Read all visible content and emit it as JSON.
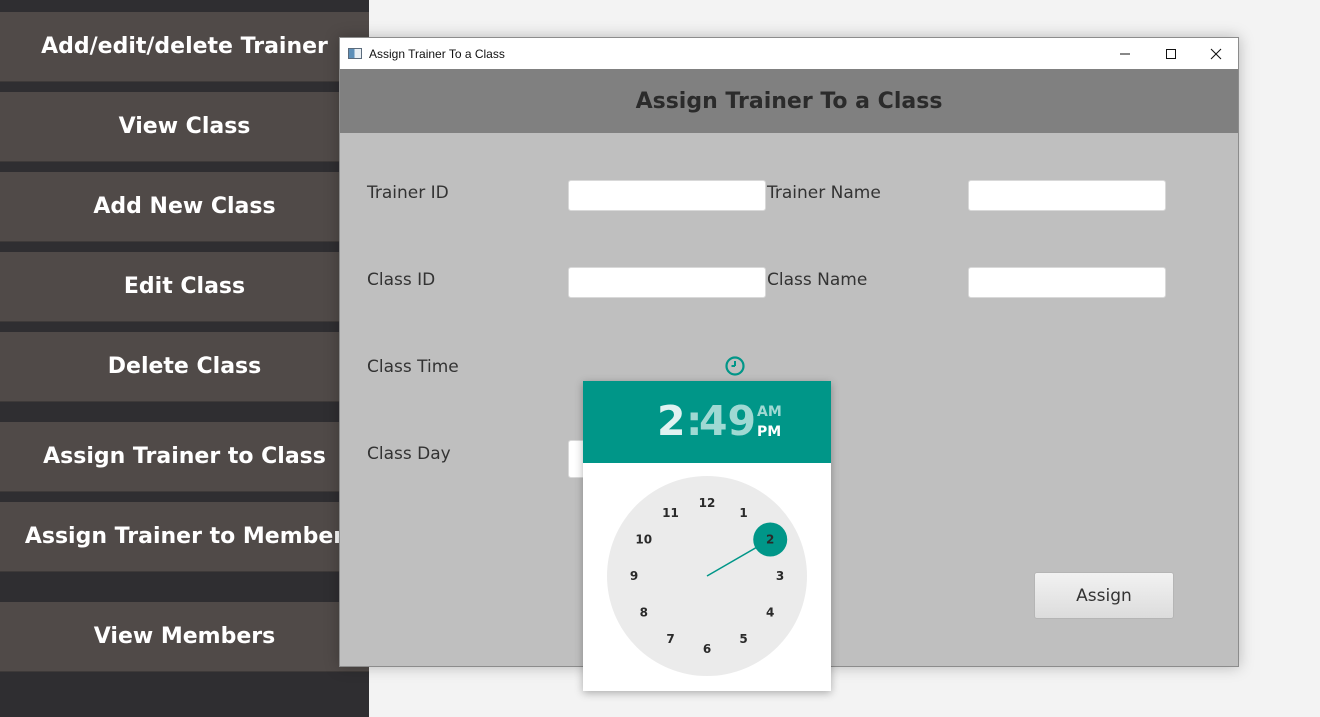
{
  "sidebar": {
    "items": [
      {
        "label": "Add/edit/delete Trainer"
      },
      {
        "label": "View Class"
      },
      {
        "label": "Add New Class"
      },
      {
        "label": "Edit Class"
      },
      {
        "label": "Delete Class"
      },
      {
        "label": "Assign Trainer to Class"
      },
      {
        "label": "Assign Trainer to Member"
      },
      {
        "label": "View Members"
      }
    ]
  },
  "window": {
    "title": "Assign Trainer To a Class",
    "header": "Assign Trainer To a Class",
    "controls": [
      "minimize-icon",
      "maximize-icon",
      "close-icon"
    ]
  },
  "form": {
    "trainer_id_label": "Trainer ID",
    "trainer_id_value": "",
    "trainer_name_label": "Trainer Name",
    "trainer_name_value": "",
    "class_id_label": "Class ID",
    "class_id_value": "",
    "class_name_label": "Class Name",
    "class_name_value": "",
    "class_time_label": "Class Time",
    "class_day_label": "Class Day",
    "assign_label": "Assign"
  },
  "time_picker": {
    "hour": "2",
    "colon": ":",
    "minute": "49",
    "am": "AM",
    "pm": "PM",
    "selected_period": "PM",
    "selected_hour": "2",
    "dial_numbers": [
      "12",
      "1",
      "2",
      "3",
      "4",
      "5",
      "6",
      "7",
      "8",
      "9",
      "10",
      "11"
    ]
  },
  "colors": {
    "accent": "#009688",
    "sidebar_button": "#504a48",
    "sidebar_bg": "#2f2e31",
    "header_band": "#808080",
    "form_bg": "#bfbfbf"
  }
}
